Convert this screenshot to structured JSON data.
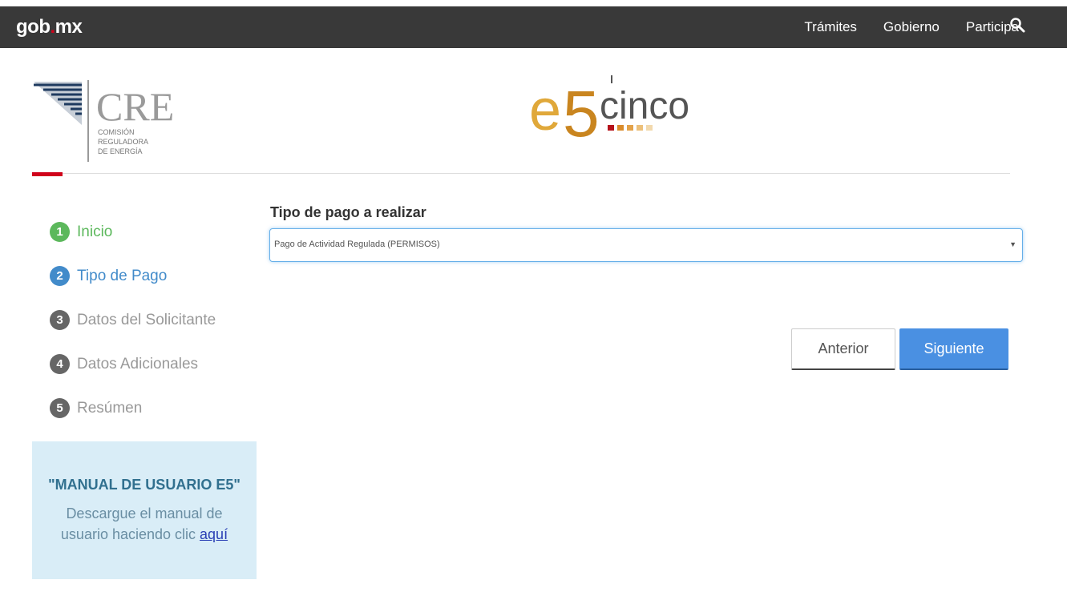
{
  "header": {
    "brand_main": "gob",
    "brand_dot": ".",
    "brand_suffix": "mx",
    "nav": [
      "Trámites",
      "Gobierno",
      "Participa"
    ],
    "search_icon": "search-icon"
  },
  "logos": {
    "cre_title": "CRE",
    "cre_lines": [
      "COMISIÓN",
      "REGULADORA",
      "DE ENERGÍA"
    ],
    "e5_prefix": "e",
    "e5_number": "5",
    "e5_suffix": "cinco"
  },
  "steps": [
    {
      "num": "1",
      "label": "Inicio",
      "state": "done"
    },
    {
      "num": "2",
      "label": "Tipo de Pago",
      "state": "active"
    },
    {
      "num": "3",
      "label": "Datos del Solicitante",
      "state": "pending"
    },
    {
      "num": "4",
      "label": "Datos Adicionales",
      "state": "pending"
    },
    {
      "num": "5",
      "label": "Resúmen",
      "state": "pending"
    }
  ],
  "manual": {
    "title": "\"MANUAL DE USUARIO E5\"",
    "text_line1": "Descargue el manual de",
    "text_line2": "usuario haciendo clic ",
    "link": "aquí"
  },
  "form": {
    "label": "Tipo de pago a realizar",
    "selected": "Pago de Actividad Regulada (PERMISOS)"
  },
  "buttons": {
    "prev": "Anterior",
    "next": "Siguiente"
  },
  "colors": {
    "topbar": "#393939",
    "accent_red": "#d0021b",
    "step_done": "#5cb85c",
    "step_active": "#428bca",
    "step_pending": "#666666",
    "button_primary": "#4a90e2",
    "manual_bg": "#d9edf7"
  }
}
